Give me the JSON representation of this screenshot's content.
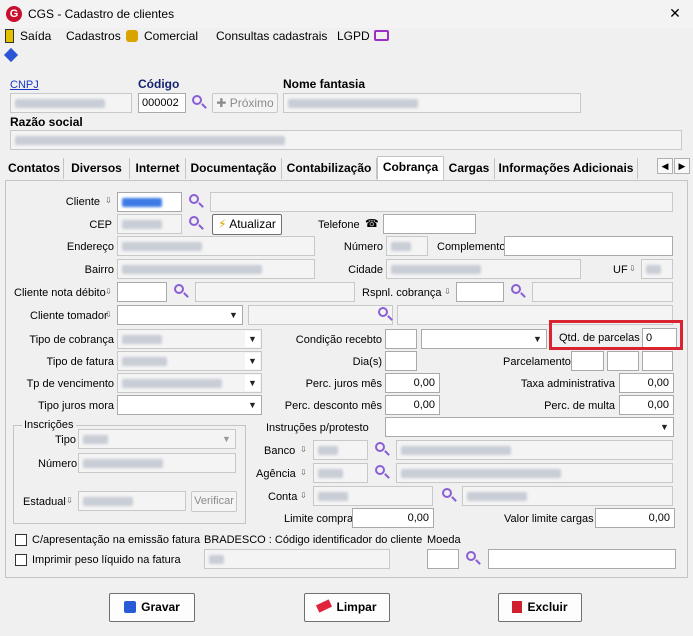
{
  "window": {
    "title": "CGS - Cadastro de clientes",
    "close": "✕"
  },
  "menu": {
    "saida": "Saída",
    "cadastros": "Cadastros",
    "comercial": "Comercial",
    "consultas": "Consultas cadastrais",
    "lgpd": "LGPD"
  },
  "header": {
    "cnpj_label": "CNPJ",
    "codigo_label": "Código",
    "codigo_value": "000002",
    "proximo_label": "Próximo",
    "nome_fantasia_label": "Nome fantasia",
    "razao_social_label": "Razão social"
  },
  "tabs": [
    "Contatos",
    "Diversos",
    "Internet",
    "Documentação",
    "Contabilização",
    "Cobrança",
    "Cargas",
    "Informações Adicionais"
  ],
  "cobranca": {
    "cliente": "Cliente",
    "cep": "CEP",
    "atualizar": "Atualizar",
    "telefone": "Telefone",
    "endereco": "Endereço",
    "numero": "Número",
    "complemento": "Complemento",
    "bairro": "Bairro",
    "cidade": "Cidade",
    "uf": "UF",
    "cliente_nota_debito": "Cliente nota débito",
    "rspnl_cobranca": "Rspnl. cobrança",
    "cliente_tomador": "Cliente tomador",
    "tipo_cobranca": "Tipo de cobrança",
    "condicao_recebto": "Condição recebto",
    "qtd_parcelas": "Qtd. de parcelas",
    "qtd_parcelas_value": "0",
    "tipo_fatura": "Tipo de fatura",
    "dias": "Dia(s)",
    "parcelamento": "Parcelamento",
    "tp_vencimento": "Tp de vencimento",
    "perc_juros_mes": "Perc. juros mês",
    "perc_juros_mes_value": "0,00",
    "taxa_administrativa": "Taxa administrativa",
    "taxa_administrativa_value": "0,00",
    "tipo_juros_mora": "Tipo juros mora",
    "perc_desconto_mes": "Perc. desconto mês",
    "perc_desconto_mes_value": "0,00",
    "perc_multa": "Perc. de multa",
    "perc_multa_value": "0,00",
    "inscricoes": "Inscrições",
    "tipo": "Tipo",
    "numero_insc": "Número",
    "estadual": "Estadual",
    "verificar": "Verificar",
    "instrucoes": "Instruções p/protesto",
    "banco": "Banco",
    "agencia": "Agência",
    "conta": "Conta",
    "limite_compra": "Limite compra",
    "limite_compra_value": "0,00",
    "valor_limite_cargas": "Valor limite cargas",
    "valor_limite_cargas_value": "0,00",
    "apresentacao": "C/apresentação na emissão fatura",
    "bradesco": "BRADESCO : Código identificador do cliente",
    "moeda": "Moeda",
    "imprimir_peso": "Imprimir peso líquido na fatura"
  },
  "footer": {
    "gravar": "Gravar",
    "limpar": "Limpar",
    "excluir": "Excluir"
  }
}
